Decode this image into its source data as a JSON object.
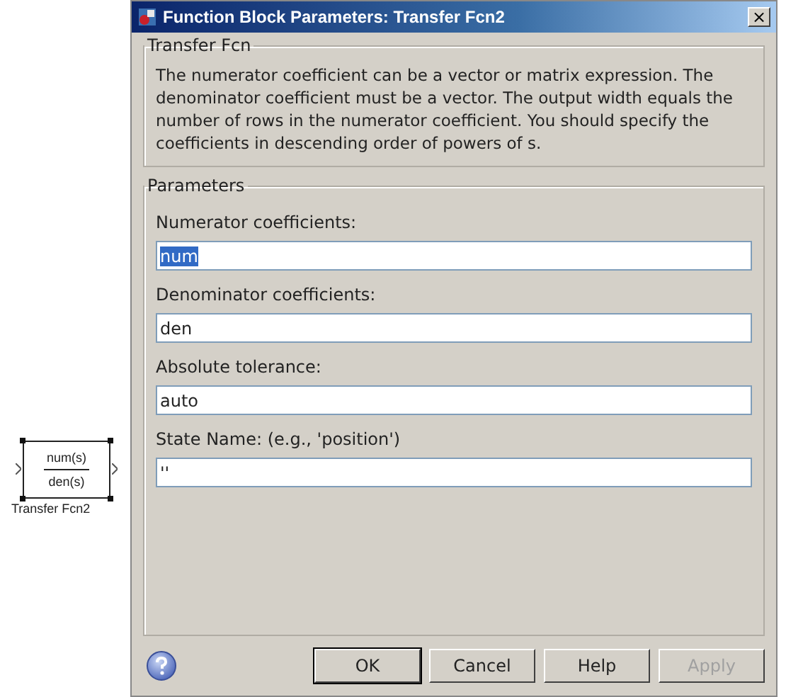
{
  "block": {
    "numerator": "num(s)",
    "denominator": "den(s)",
    "label": "Transfer Fcn2"
  },
  "window": {
    "title": "Function Block Parameters: Transfer Fcn2",
    "close": "×"
  },
  "description_group": {
    "title": "Transfer Fcn",
    "text": "The numerator coefficient can be a vector or matrix expression. The denominator coefficient must be a vector. The output width equals the number of rows in the numerator coefficient. You should specify the coefficients in descending order of powers of s."
  },
  "parameters_group": {
    "title": "Parameters",
    "fields": [
      {
        "label": "Numerator coefficients:",
        "value": "num",
        "selected": true
      },
      {
        "label": "Denominator coefficients:",
        "value": "den",
        "selected": false
      },
      {
        "label": "Absolute tolerance:",
        "value": "auto",
        "selected": false
      },
      {
        "label": "State Name: (e.g., 'position')",
        "value": "''",
        "selected": false
      }
    ]
  },
  "buttons": [
    {
      "label": "OK",
      "disabled": false,
      "default": true
    },
    {
      "label": "Cancel",
      "disabled": false,
      "default": false
    },
    {
      "label": "Help",
      "disabled": false,
      "default": false
    },
    {
      "label": "Apply",
      "disabled": true,
      "default": false
    }
  ]
}
